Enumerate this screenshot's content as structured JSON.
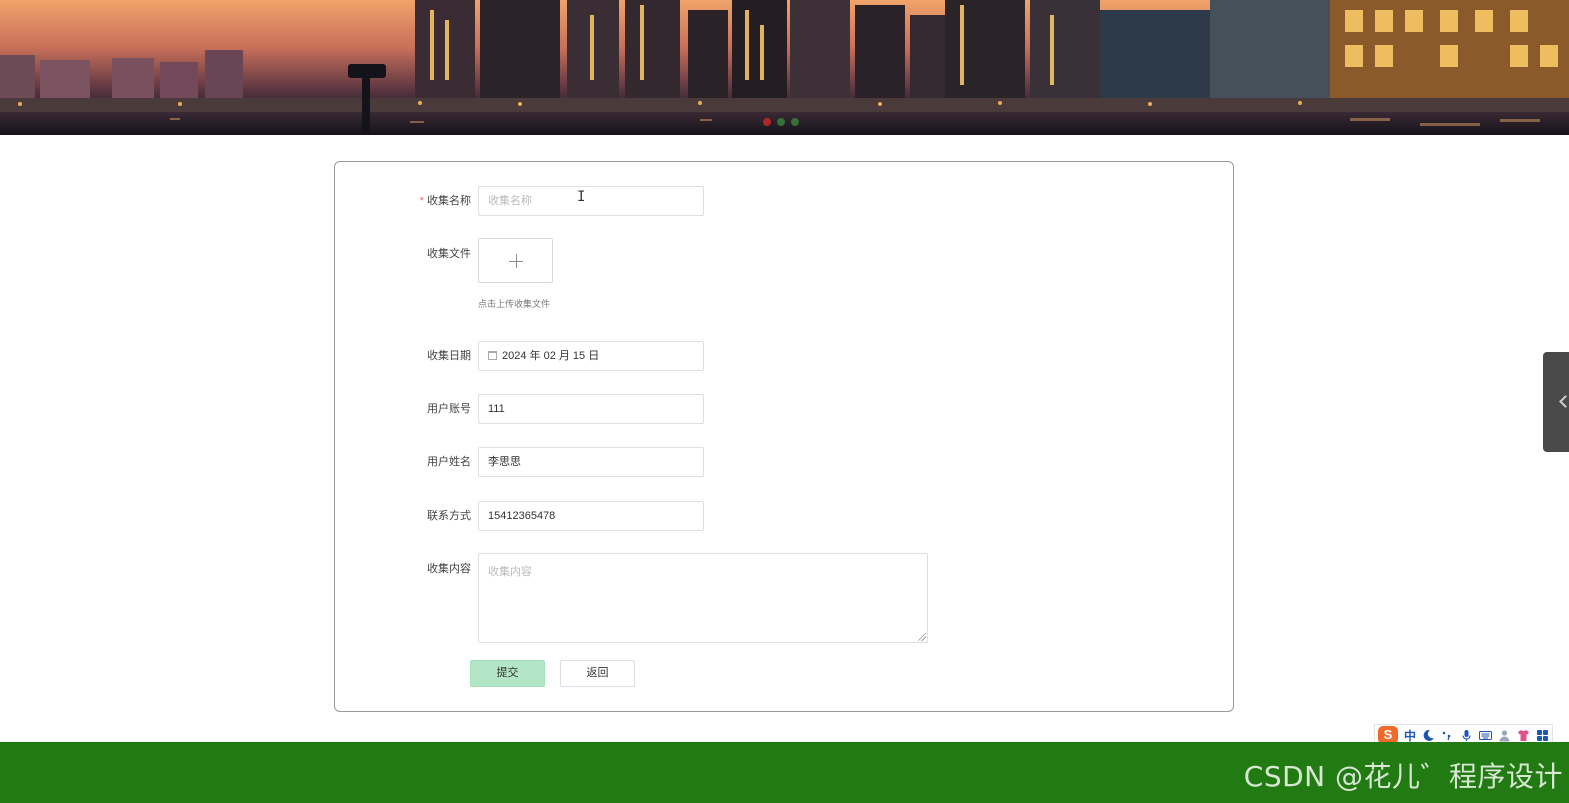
{
  "form": {
    "fields": {
      "name": {
        "label": "收集名称",
        "required_mark": "*",
        "placeholder": "收集名称"
      },
      "file": {
        "label": "收集文件",
        "hint": "点击上传收集文件"
      },
      "date": {
        "label": "收集日期",
        "value": "2024 年 02 月 15 日"
      },
      "account": {
        "label": "用户账号",
        "value": "111"
      },
      "username": {
        "label": "用户姓名",
        "value": "李思思"
      },
      "contact": {
        "label": "联系方式",
        "value": "15412365478"
      },
      "content": {
        "label": "收集内容",
        "placeholder": "收集内容"
      }
    },
    "buttons": {
      "submit": "提交",
      "back": "返回"
    }
  },
  "banner": {
    "active_slide": 1,
    "slide_count": 3
  },
  "ime_toolbar": {
    "logo": "S",
    "mode": "中"
  },
  "footer": {
    "watermark": "CSDN @花儿゛程序设计"
  },
  "colors": {
    "footer_bg": "#217a12",
    "submit_bg": "#b3e6c6",
    "required": "#f56c6c"
  },
  "icons": [
    "calendar-icon",
    "plus-icon",
    "chevron-left-icon",
    "sogou-logo-icon",
    "moon-icon",
    "mic-icon",
    "keyboard-icon",
    "user-icon",
    "shirt-icon",
    "grid-icon"
  ]
}
